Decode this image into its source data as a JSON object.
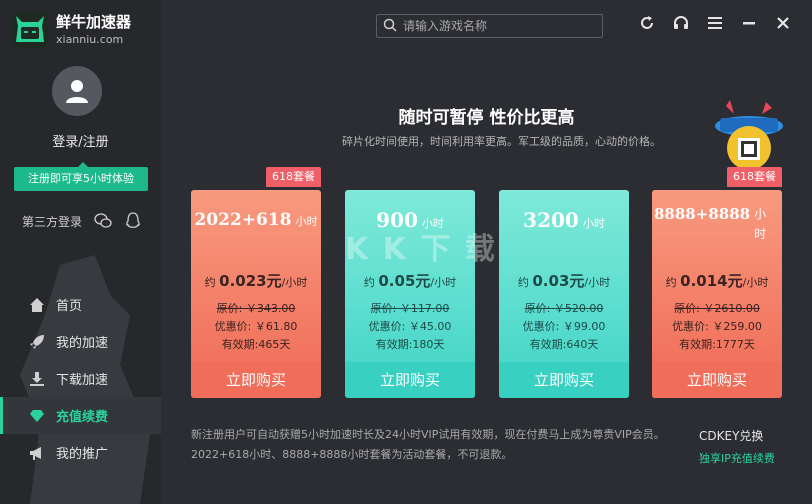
{
  "app": {
    "name": "鲜牛加速器",
    "domain": "xianniu.com",
    "brand_color": "#2ad39c"
  },
  "account": {
    "login_label": "登录/注册",
    "trial_badge": "注册即可享5小时体验",
    "third_party_label": "第三方登录"
  },
  "nav": {
    "items": [
      {
        "label": "首页",
        "icon": "home-icon"
      },
      {
        "label": "我的加速",
        "icon": "rocket-icon"
      },
      {
        "label": "下载加速",
        "icon": "download-icon"
      },
      {
        "label": "充值续费",
        "icon": "diamond-icon",
        "active": true
      },
      {
        "label": "我的推广",
        "icon": "megaphone-icon"
      }
    ]
  },
  "search": {
    "placeholder": "请输入游戏名称"
  },
  "promo": {
    "headline": "随时可暂停 性价比更高",
    "subline": "碎片化时间使用，时间利用率更高。军工级的品质，心动的价格。"
  },
  "plans": [
    {
      "tag": "618套餐",
      "title": "2022+618",
      "unit": "小时",
      "per_prefix": "约",
      "per_price": "0.023元",
      "per_suffix": "/小时",
      "orig": "原价: ￥343.00",
      "sale": "优惠价: ￥61.80",
      "valid": "有效期:465天",
      "buy": "立即购买",
      "theme": "red"
    },
    {
      "tag": "",
      "title": "900",
      "unit": "小时",
      "per_prefix": "约",
      "per_price": "0.05元",
      "per_suffix": "/小时",
      "orig": "原价: ￥117.00",
      "sale": "优惠价: ￥45.00",
      "valid": "有效期:180天",
      "buy": "立即购买",
      "theme": "teal"
    },
    {
      "tag": "",
      "title": "3200",
      "unit": "小时",
      "per_prefix": "约",
      "per_price": "0.03元",
      "per_suffix": "/小时",
      "orig": "原价: ￥520.00",
      "sale": "优惠价: ￥99.00",
      "valid": "有效期:640天",
      "buy": "立即购买",
      "theme": "teal"
    },
    {
      "tag": "618套餐",
      "title": "8888+8888",
      "unit": "小时",
      "per_prefix": "约",
      "per_price": "0.014元",
      "per_suffix": "/小时",
      "orig": "原价: ￥2610.00",
      "sale": "优惠价: ￥259.00",
      "valid": "有效期:1777天",
      "buy": "立即购买",
      "theme": "red"
    }
  ],
  "footer": {
    "note_line1": "新注册用户可自动获赠5小时加速时长及24小时VIP试用有效期，现在付费马上成为尊贵VIP会员。",
    "note_line2": "2022+618小时、8888+8888小时套餐为活动套餐，不可退款。",
    "cdkey": "CDKEY兑换",
    "exclusive_ip": "独享IP充值续费"
  },
  "watermark": "K K 下 载"
}
